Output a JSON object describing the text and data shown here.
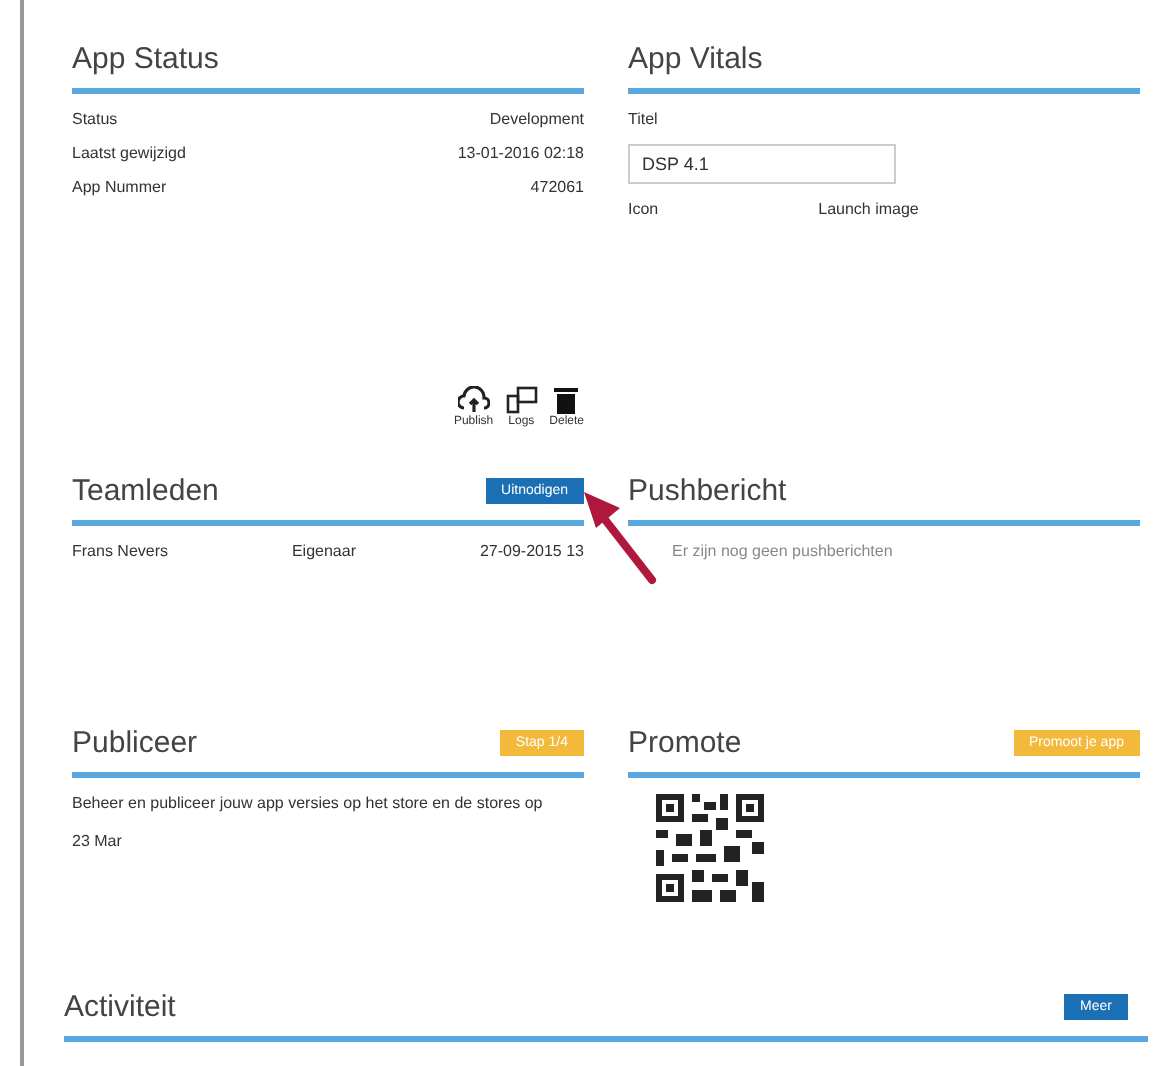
{
  "app_status": {
    "title": "App Status",
    "rows": [
      {
        "label": "Status",
        "value": "Development"
      },
      {
        "label": "Laatst gewijzigd",
        "value": "13-01-2016 02:18"
      },
      {
        "label": "App Nummer",
        "value": "472061"
      }
    ],
    "actions": [
      {
        "label": "Publish",
        "kind": "cloud"
      },
      {
        "label": "Logs",
        "kind": "devices"
      },
      {
        "label": "Delete",
        "kind": "trash"
      }
    ]
  },
  "app_vitals": {
    "title": "App Vitals",
    "field_label": "Titel",
    "field_value": "DSP 4.1",
    "icon_label": "Icon",
    "launch_label": "Launch image"
  },
  "teamleden": {
    "title": "Teamleden",
    "button": "Uitnodigen",
    "members": [
      {
        "name": "Frans Nevers",
        "role": "Eigenaar",
        "date": "27-09-2015 13"
      }
    ]
  },
  "pushbericht": {
    "title": "Pushbericht",
    "text": "Er zijn nog geen pushberichten"
  },
  "publiceer": {
    "title": "Publiceer",
    "button": "Stap 1/4",
    "text": "Beheer en publiceer jouw app versies op het store en de stores op",
    "date": "23 Mar"
  },
  "promote": {
    "title": "Promote",
    "button": "Promoot je app"
  },
  "activiteit": {
    "title": "Activiteit",
    "button": "Meer"
  }
}
